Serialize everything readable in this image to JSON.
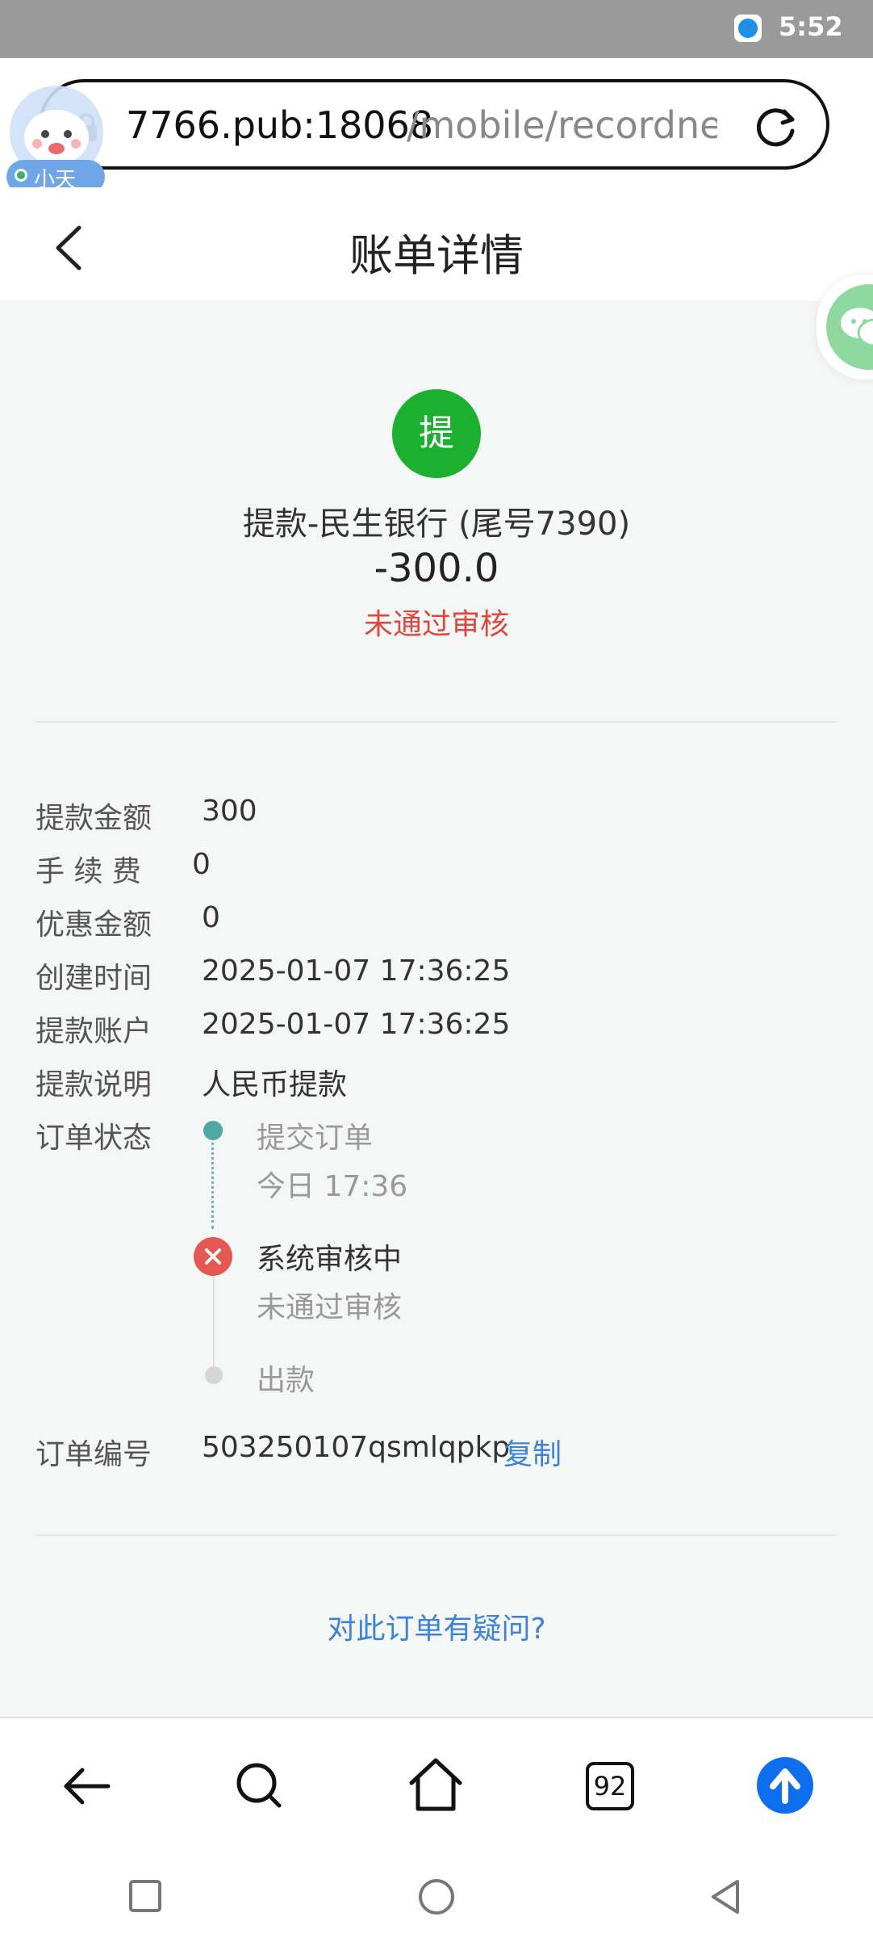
{
  "status_bar": {
    "time": "5:52"
  },
  "browser": {
    "url_host": "7766.pub:18068",
    "url_path": "/mobile/recordnew",
    "tab_count": "92"
  },
  "mascot": {
    "badge_label": "小天"
  },
  "header": {
    "title": "账单详情"
  },
  "summary": {
    "badge_char": "提",
    "title": "提款-民生银行 (尾号7390)",
    "amount": "-300.0",
    "status": "未通过审核",
    "status_color": "#e0463c",
    "badge_color": "#1bb02f"
  },
  "details": [
    {
      "label": "提款金额",
      "value": "300"
    },
    {
      "label": "手 续 费",
      "value": "0"
    },
    {
      "label": "优惠金额",
      "value": "0"
    },
    {
      "label": "创建时间",
      "value": "2025-01-07 17:36:25"
    },
    {
      "label": "提款账户",
      "value": "2025-01-07 17:36:25"
    },
    {
      "label": "提款说明",
      "value": "人民币提款"
    }
  ],
  "order_status": {
    "label": "订单状态",
    "steps": [
      {
        "title": "提交订单",
        "sub": "今日 17:36"
      },
      {
        "title": "系统审核中",
        "sub": "未通过审核"
      },
      {
        "title": "出款",
        "sub": ""
      }
    ]
  },
  "order_number": {
    "label": "订单编号",
    "value": "503250107qsmlqpkp",
    "copy_label": "复制"
  },
  "question_link": "对此订单有疑问?",
  "accent_color": "#3b82d8"
}
